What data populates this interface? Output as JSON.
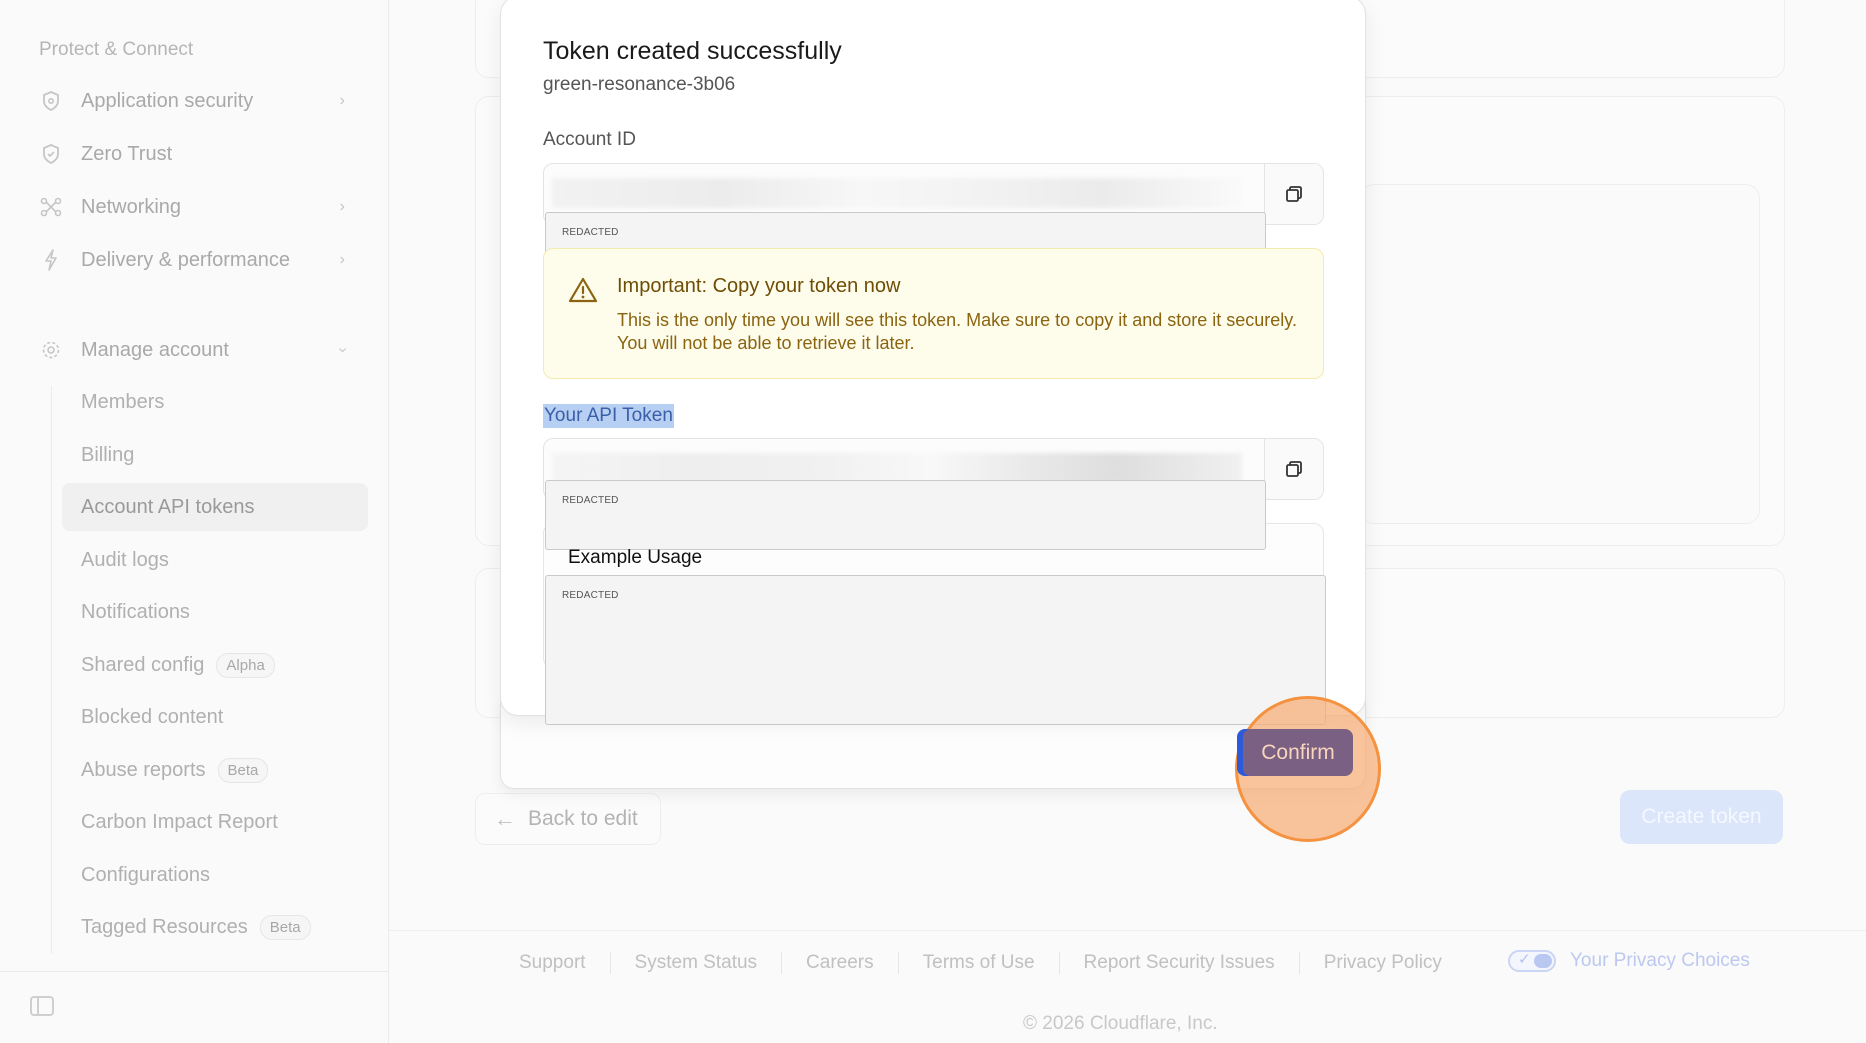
{
  "sidebar": {
    "section_title": "Protect & Connect",
    "items": [
      {
        "label": "Application security",
        "icon": "shield-icon",
        "has_chevron": true
      },
      {
        "label": "Zero Trust",
        "icon": "shield-lock-icon",
        "has_chevron": false
      },
      {
        "label": "Networking",
        "icon": "network-icon",
        "has_chevron": true
      },
      {
        "label": "Delivery & performance",
        "icon": "bolt-icon",
        "has_chevron": true
      }
    ],
    "manage": {
      "label": "Manage account",
      "icon": "gear-icon",
      "expanded": true,
      "subitems": [
        {
          "label": "Members",
          "badge": ""
        },
        {
          "label": "Billing",
          "badge": ""
        },
        {
          "label": "Account API tokens",
          "badge": "",
          "active": true
        },
        {
          "label": "Audit logs",
          "badge": ""
        },
        {
          "label": "Notifications",
          "badge": ""
        },
        {
          "label": "Shared config",
          "badge": "Alpha"
        },
        {
          "label": "Blocked content",
          "badge": ""
        },
        {
          "label": "Abuse reports",
          "badge": "Beta"
        },
        {
          "label": "Carbon Impact Report",
          "badge": ""
        },
        {
          "label": "Configurations",
          "badge": ""
        },
        {
          "label": "Tagged Resources",
          "badge": "Beta"
        }
      ]
    }
  },
  "page": {
    "back_label": "Back to edit",
    "create_label": "Create token"
  },
  "modal": {
    "title": "Token created successfully",
    "token_name": "green-resonance-3b06",
    "account_id_label": "Account ID",
    "account_redacted": "REDACTED",
    "warning": {
      "title": "Important: Copy your token now",
      "text": "This is the only time you will see this token. Make sure to copy it and store it securely. You will not be able to retrieve it later."
    },
    "token_label": "Your API Token",
    "token_redacted": "REDACTED",
    "example_title": "Example Usage",
    "example_redacted": "REDACTED",
    "confirm_label": "Confirm"
  },
  "footer": {
    "links": [
      "Support",
      "System Status",
      "Careers",
      "Terms of Use",
      "Report Security Issues",
      "Privacy Policy"
    ],
    "privacy_choices": "Your Privacy Choices",
    "copyright": "© 2026 Cloudflare, Inc."
  },
  "colors": {
    "accent": "#2d5ad8",
    "warning_bg": "#fefcea",
    "highlight": "#f5923f"
  }
}
